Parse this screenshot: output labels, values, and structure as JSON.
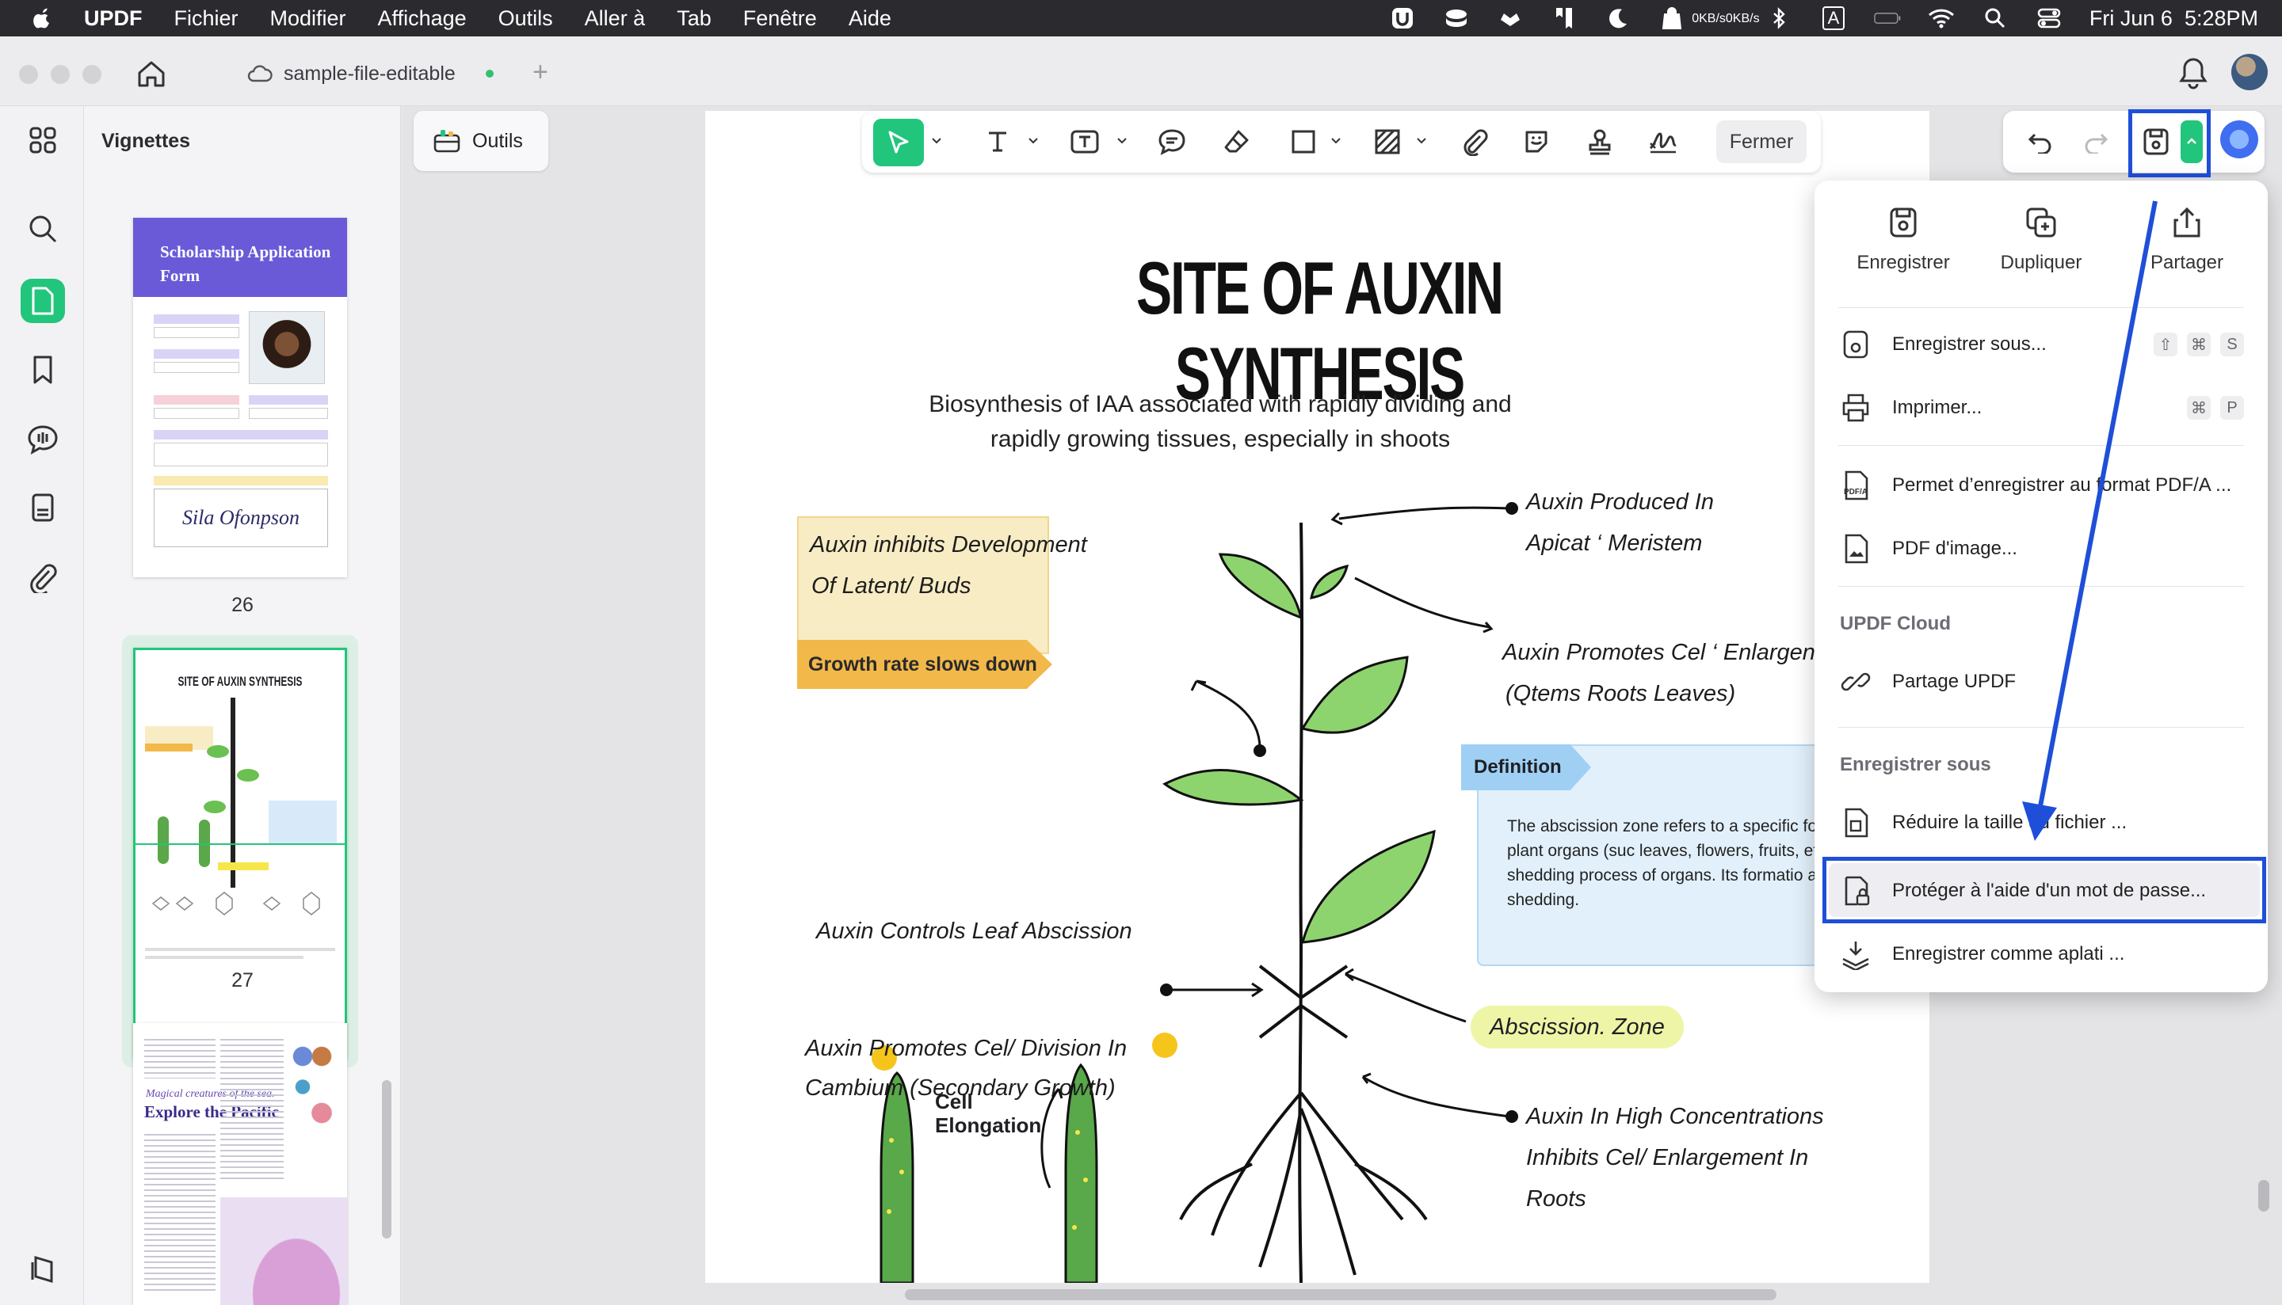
{
  "menubar": {
    "app": "UPDF",
    "items": [
      "Fichier",
      "Modifier",
      "Affichage",
      "Outils",
      "Aller à",
      "Tab",
      "Fenêtre",
      "Aide"
    ],
    "net_up": "0KB/s",
    "net_down": "0KB/s",
    "input_source": "A",
    "datetime": "Fri Jun 6  5:28PM"
  },
  "titlebar": {
    "doc_tab": "sample-file-editable",
    "add_tab": "+"
  },
  "thumbs": {
    "title": "Vignettes",
    "pages": [
      {
        "num": "26",
        "title": "Scholarship Application Form",
        "signature": "Sila Ofonpson"
      },
      {
        "num": "27",
        "title": "SITE OF AUXIN SYNTHESIS"
      },
      {
        "num": "",
        "title": "Explore the Pacific",
        "subtitle": "Magical creatures of the sea."
      }
    ]
  },
  "canvas": {
    "outils": "Outils",
    "fermer": "Fermer"
  },
  "page": {
    "title": "SITE OF AUXIN SYNTHESIS",
    "subtitle_1": "Biosynthesis of IAA associated with rapidly dividing and",
    "subtitle_2": "rapidly growing tissues, especially in shoots",
    "box1_line1": "Auxin inhibits Development",
    "box1_line2": "Of Latent/ Buds",
    "box1_tag": "Growth rate slows down",
    "apical_1": "Auxin Produced In",
    "apical_2": "Apicat ‘ Meristem",
    "promotes_1": "Auxin Promotes Cel ‘ Enlargen",
    "promotes_2": "(Qtems Roots Leaves)",
    "definition_tag": "Definition",
    "definition_text": "The abscission zone refers to a specific formed at the base of plant organs (suc leaves, flowers, fruits, etc.) during the shedding process of organs. Its formatio a prerequisite for organ shedding.",
    "leaf_abscission": "Auxin Controls Leaf Abscission",
    "cambium_1": "Auxin Promotes Cel/ Division In",
    "cambium_2": "Cambium (Secondary Growth)",
    "abscission_zone": "Abscission. Zone",
    "cell_1": "Cell",
    "cell_2": "Elongation",
    "roots_1": "Auxin In High Concentrations",
    "roots_2": "Inhibits Cel/ Enlargement In",
    "roots_3": "Roots"
  },
  "dropdown": {
    "top": [
      "Enregistrer",
      "Dupliquer",
      "Partager"
    ],
    "save_as": {
      "label": "Enregistrer sous...",
      "shortcut": [
        "⇧",
        "⌘",
        "S"
      ]
    },
    "print": {
      "label": "Imprimer...",
      "shortcut": [
        "⌘",
        "P"
      ]
    },
    "pdfa": "Permet d’enregistrer au format PDF/A ...",
    "pdf_image": "PDF d'image...",
    "cloud_section": "UPDF Cloud",
    "share_updf": "Partage UPDF",
    "save_section": "Enregistrer sous",
    "reduce": "Réduire la taille du fichier ...",
    "protect": "Protéger à l'aide d'un mot de passe...",
    "flatten": "Enregistrer comme aplati ..."
  },
  "colors": {
    "accent_green": "#22c57c",
    "highlight_blue": "#1f4fd8",
    "menubar": "#2b2b2f"
  }
}
